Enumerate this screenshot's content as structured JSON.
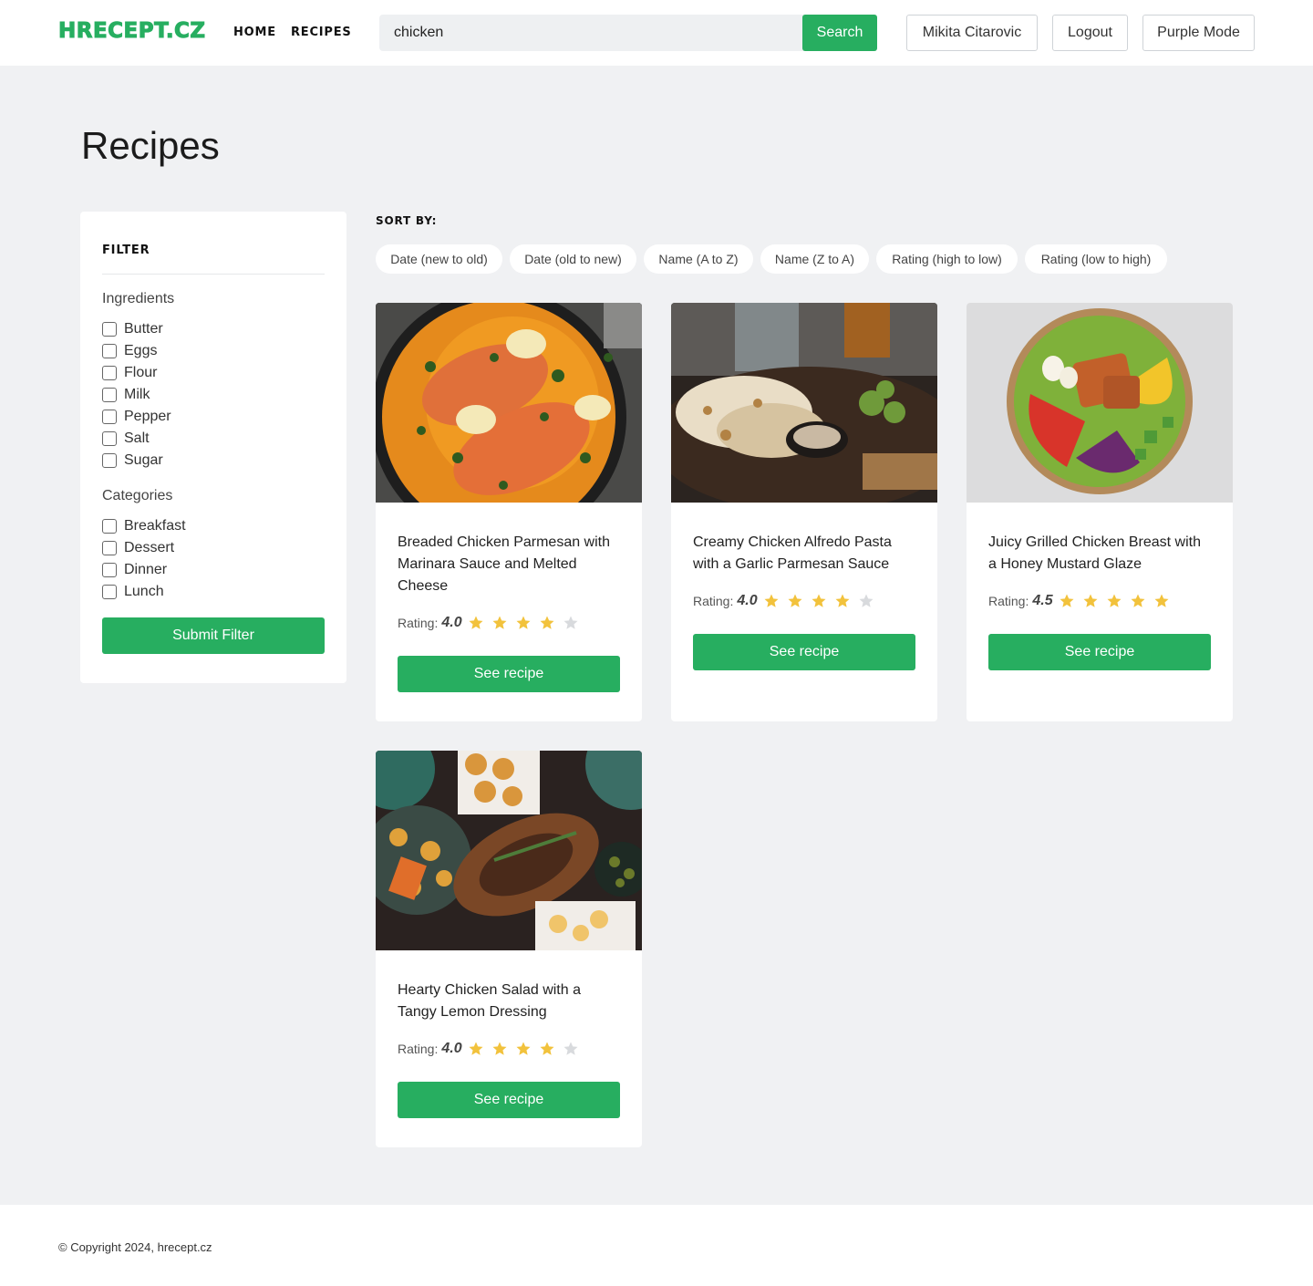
{
  "header": {
    "logo": "HRECEPT.CZ",
    "nav": [
      "HOME",
      "RECIPES"
    ],
    "search_value": "chicken",
    "search_button": "Search",
    "user_button": "Mikita Citarovic",
    "logout_button": "Logout",
    "mode_button": "Purple Mode"
  },
  "page_title": "Recipes",
  "filter": {
    "title": "FILTER",
    "ingredients_label": "Ingredients",
    "ingredients": [
      "Butter",
      "Eggs",
      "Flour",
      "Milk",
      "Pepper",
      "Salt",
      "Sugar"
    ],
    "categories_label": "Categories",
    "categories": [
      "Breakfast",
      "Dessert",
      "Dinner",
      "Lunch"
    ],
    "submit": "Submit Filter"
  },
  "sort": {
    "label": "SORT BY:",
    "options": [
      "Date (new to old)",
      "Date (old to new)",
      "Name (A to Z)",
      "Name (Z to A)",
      "Rating (high to low)",
      "Rating (low to high)"
    ]
  },
  "recipes": [
    {
      "title": "Breaded Chicken Parmesan with Marinara Sauce and Melted Cheese",
      "rating_label": "Rating:",
      "rating": "4.0",
      "stars": 4,
      "button": "See recipe"
    },
    {
      "title": "Creamy Chicken Alfredo Pasta with a Garlic Parmesan Sauce",
      "rating_label": "Rating:",
      "rating": "4.0",
      "stars": 4,
      "button": "See recipe"
    },
    {
      "title": "Juicy Grilled Chicken Breast with a Honey Mustard Glaze",
      "rating_label": "Rating:",
      "rating": "4.5",
      "stars": 5,
      "button": "See recipe"
    },
    {
      "title": "Hearty Chicken Salad with a Tangy Lemon Dressing",
      "rating_label": "Rating:",
      "rating": "4.0",
      "stars": 4,
      "button": "See recipe"
    }
  ],
  "footer": {
    "copyright": "© Copyright 2024, hrecept.cz"
  },
  "colors": {
    "accent": "#27ae60",
    "star_filled": "#f2c23c",
    "star_empty": "#d8dadd",
    "background": "#f0f1f3"
  }
}
